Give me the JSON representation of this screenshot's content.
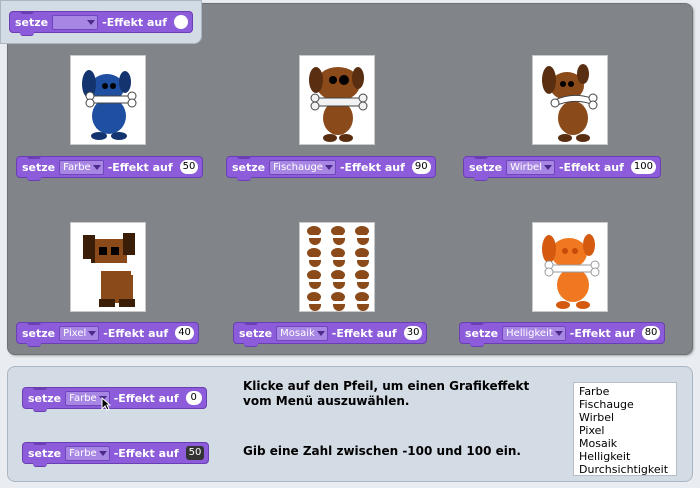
{
  "block": {
    "set": "setze",
    "effect_suffix": "-Effekt auf"
  },
  "top_block": {
    "dropdown": "",
    "value": ""
  },
  "examples": [
    {
      "effect": "Farbe",
      "value": "50"
    },
    {
      "effect": "Fischauge",
      "value": "90"
    },
    {
      "effect": "Wirbel",
      "value": "100"
    },
    {
      "effect": "Pixel",
      "value": "40"
    },
    {
      "effect": "Mosaik",
      "value": "30"
    },
    {
      "effect": "Helligkeit",
      "value": "80"
    }
  ],
  "help": {
    "block1": {
      "effect": "Farbe",
      "value": "0"
    },
    "block2": {
      "effect": "Farbe",
      "value": "50"
    },
    "line1a": "Klicke auf den Pfeil, um einen Grafikeffekt",
    "line1b": "vom Menü auszuwählen.",
    "line2": "Gib eine Zahl zwischen -100 und 100 ein."
  },
  "menu": [
    "Farbe",
    "Fischauge",
    "Wirbel",
    "Pixel",
    "Mosaik",
    "Helligkeit",
    "Durchsichtigkeit"
  ],
  "colors": {
    "block_purple": "#8c5cda",
    "stage_gray": "#818589",
    "dog_blue": "#1f4fa0",
    "dog_brown": "#8a4a1a",
    "dog_orange": "#f07820"
  }
}
